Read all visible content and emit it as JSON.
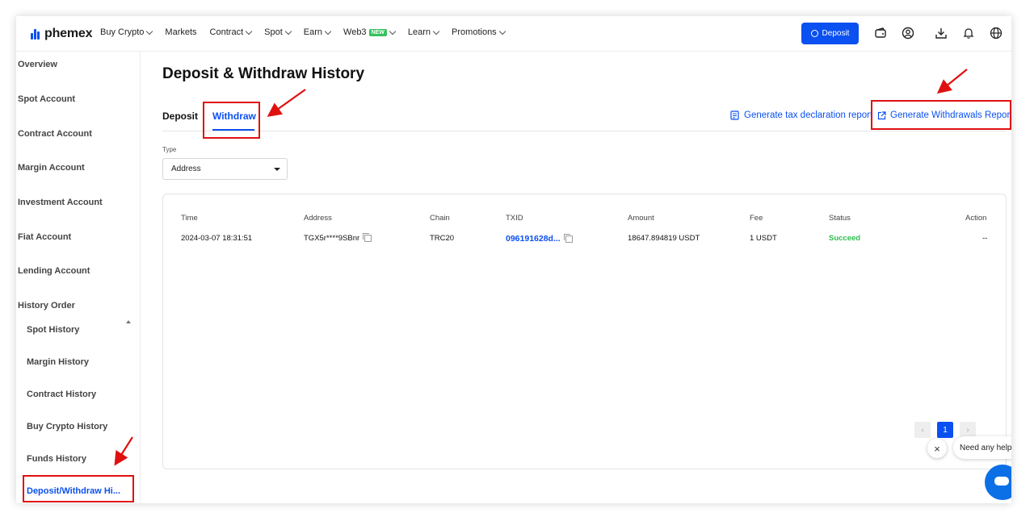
{
  "brand": {
    "name": "phemex",
    "accent": "#0b50f0"
  },
  "nav": {
    "items": [
      {
        "label": "Buy Crypto",
        "dropdown": true
      },
      {
        "label": "Markets",
        "dropdown": false
      },
      {
        "label": "Contract",
        "dropdown": true
      },
      {
        "label": "Spot",
        "dropdown": true
      },
      {
        "label": "Earn",
        "dropdown": true
      },
      {
        "label": "Web3",
        "dropdown": true,
        "badge": "NEW"
      },
      {
        "label": "Learn",
        "dropdown": true
      },
      {
        "label": "Promotions",
        "dropdown": true
      }
    ],
    "deposit_label": "Deposit"
  },
  "sidebar": {
    "items": [
      "Overview",
      "Spot Account",
      "Contract Account",
      "Margin Account",
      "Investment Account",
      "Fiat Account",
      "Lending Account",
      "History Order"
    ],
    "subitems": [
      "Spot History",
      "Margin History",
      "Contract History",
      "Buy Crypto History",
      "Funds History",
      "Deposit/Withdraw Hi..."
    ]
  },
  "page": {
    "title": "Deposit & Withdraw History",
    "tabs": [
      "Deposit",
      "Withdraw"
    ],
    "active_tab": "Withdraw",
    "tax_report_link": "Generate tax declaration report",
    "withdrawals_report_link": "Generate Withdrawals Report"
  },
  "filter": {
    "type_label": "Type",
    "type_value": "Address"
  },
  "table": {
    "columns": [
      "Time",
      "Address",
      "Chain",
      "TXID",
      "Amount",
      "Fee",
      "Status",
      "Action"
    ],
    "rows": [
      {
        "time": "2024-03-07 18:31:51",
        "address": "TGX5r****9SBnr",
        "chain": "TRC20",
        "txid": "096191628d...",
        "amount": "18647.894819 USDT",
        "fee": "1 USDT",
        "status": "Succeed",
        "action": "--"
      }
    ]
  },
  "pagination": {
    "prev": "‹",
    "current": "1",
    "next": "›"
  },
  "chat": {
    "close": "×",
    "prompt": "Need any help?"
  }
}
